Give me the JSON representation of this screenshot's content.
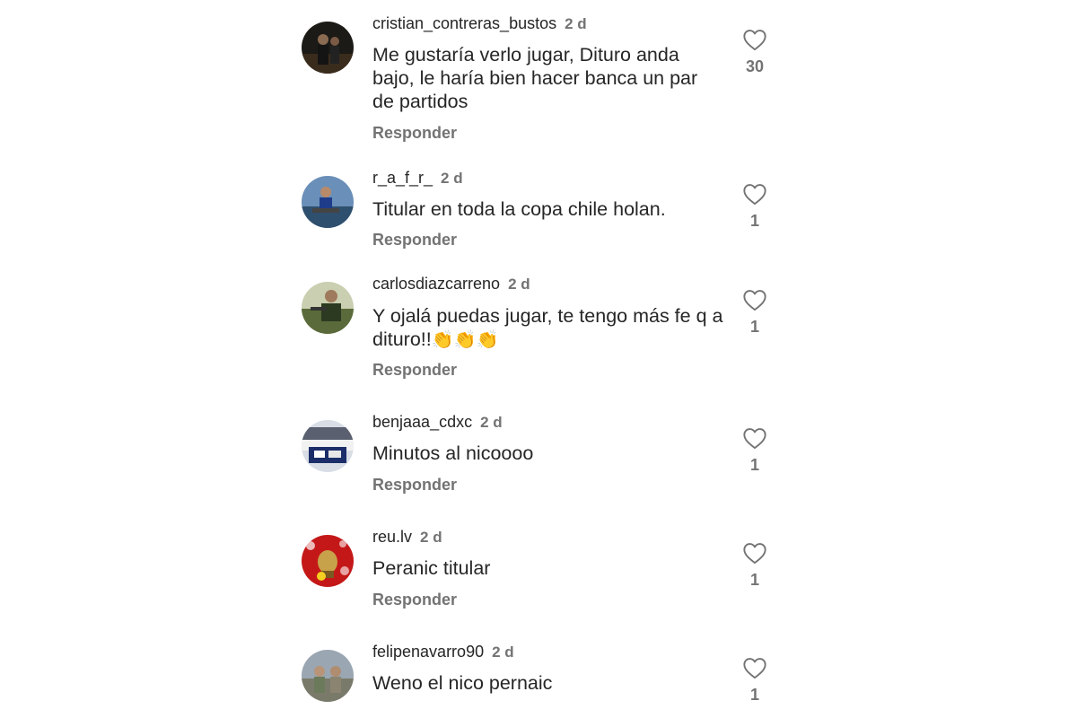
{
  "colors": {
    "text": "#262626",
    "secondary": "#737373",
    "background": "#ffffff"
  },
  "reply_label": "Responder",
  "comments": [
    {
      "username": "cristian_contreras_bustos",
      "time": "2 d",
      "text": "Me gustaría verlo jugar, Dituro anda bajo, le haría bien hacer banca un par de partidos",
      "likes": "30"
    },
    {
      "username": "r_a_f_r_",
      "time": "2 d",
      "text": "Titular en toda la copa chile holan.",
      "likes": "1"
    },
    {
      "username": "carlosdiazcarreno",
      "time": "2 d",
      "text": "Y ojalá puedas jugar, te tengo más fe q a dituro!!",
      "emoji": "👏👏👏",
      "likes": "1"
    },
    {
      "username": "benjaaa_cdxc",
      "time": "2 d",
      "text": "Minutos al nicoooo",
      "likes": "1"
    },
    {
      "username": "reu.lv",
      "time": "2 d",
      "text": "Peranic titular",
      "likes": "1"
    },
    {
      "username": "felipenavarro90",
      "time": "2 d",
      "text": "Weno el nico pernaic",
      "likes": "1"
    }
  ]
}
